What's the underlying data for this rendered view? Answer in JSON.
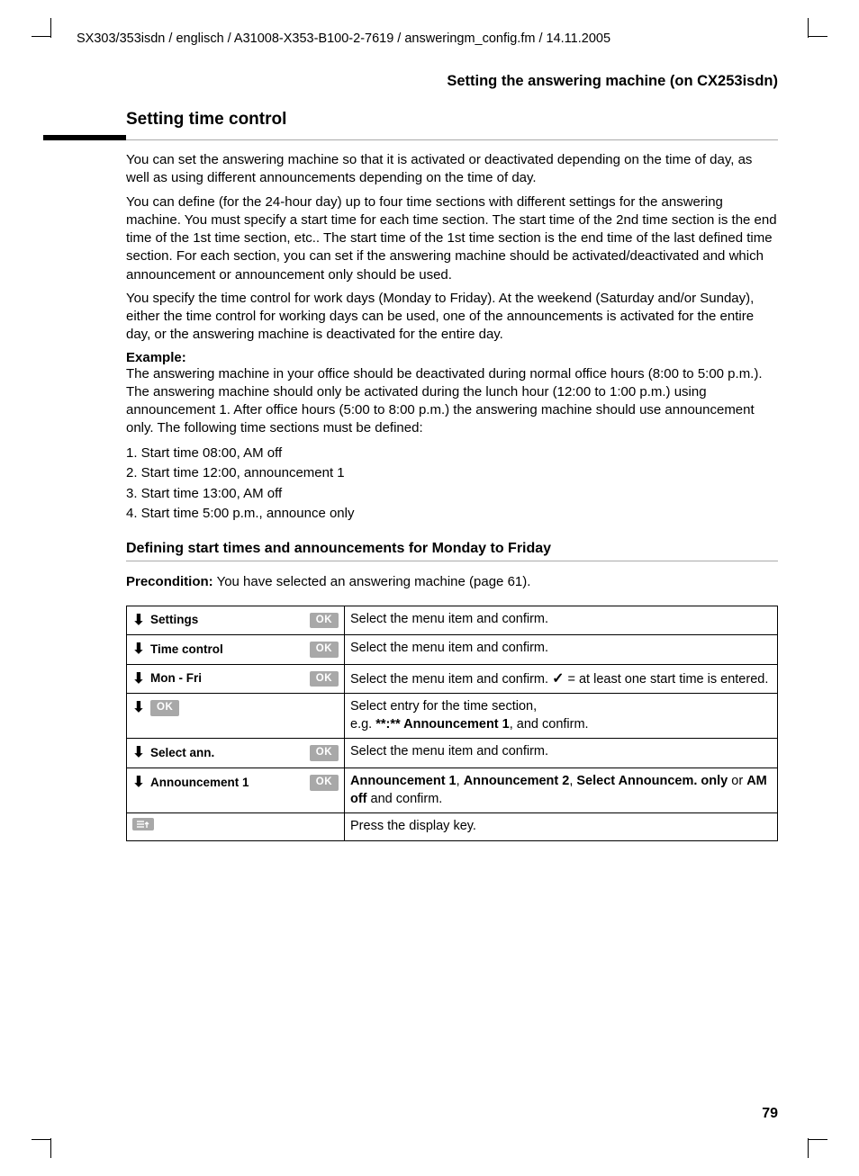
{
  "header_path": "SX303/353isdn / englisch / A31008-X353-B100-2-7619 / answeringm_config.fm / 14.11.2005",
  "breadcrumb": "Setting the answering machine (on CX253isdn)",
  "h2": "Setting time control",
  "para1": "You can set the answering machine so that it is activated or deactivated depending on the time of day, as well as using different announcements depending on the time of day.",
  "para2": "You can define (for the 24-hour day) up to four time sections with different settings for the answering machine. You must specify a start time for each time section. The start time of the 2nd time section is the end time of the 1st time section, etc.. The start time of the 1st time section is the end time of the last defined time section. For each section, you can set if the answering machine should be activated/deactivated and which announcement or announcement only should be used.",
  "para3": "You specify the time control for work days (Monday to Friday). At the weekend (Saturday and/or Sunday), either the time control for working days can be used, one of the announcements is activated for the entire day, or the answering machine is deactivated for the entire day.",
  "example_label": "Example:",
  "example_para": "The answering machine in your office should be deactivated during normal office hours (8:00 to 5:00 p.m.). The answering machine should only be activated during the lunch hour (12:00 to 1:00 p.m.) using announcement 1. After office hours (5:00 to 8:00 p.m.) the answering machine should use announcement only. The following time sections must be defined:",
  "steps": [
    "1.  Start time 08:00, AM off",
    "2.  Start time 12:00, announcement 1",
    "3.  Start time 13:00, AM off",
    "4.  Start time 5:00 p.m., announce only"
  ],
  "h3": "Defining start times and announcements for Monday to Friday",
  "precondition_label": "Precondition:",
  "precondition_text": " You have selected an answering machine (page 61).",
  "ok": "OK",
  "rows": [
    {
      "menu": "Settings",
      "ok": true,
      "desc": "Select the menu item and confirm."
    },
    {
      "menu": "Time control",
      "ok": true,
      "desc": "Select the menu item and confirm."
    },
    {
      "menu": "Mon - Fri",
      "ok": true,
      "desc_pre": "Select the menu item and confirm. ",
      "check": "✓",
      "desc_post": " = at least one start time is entered."
    },
    {
      "menu": "",
      "ok_only": true,
      "desc_pre": "Select entry for the time section,\ne.g. ",
      "b": "**:** Announcement 1",
      "desc_post": ", and confirm."
    },
    {
      "menu": "Select ann.",
      "ok": true,
      "desc": "Select the menu item and confirm."
    },
    {
      "menu": "Announcement 1",
      "ok": true,
      "desc_rich": true,
      "b1": "Announcement 1",
      "sep1": ", ",
      "b2": "Announcement 2",
      "sep2": ", ",
      "b3": "Select Announcem. only",
      "mid": " or ",
      "b4": "AM off",
      "end": " and confirm."
    }
  ],
  "press_row": {
    "desc": "Press the display key."
  },
  "page_number": "79"
}
